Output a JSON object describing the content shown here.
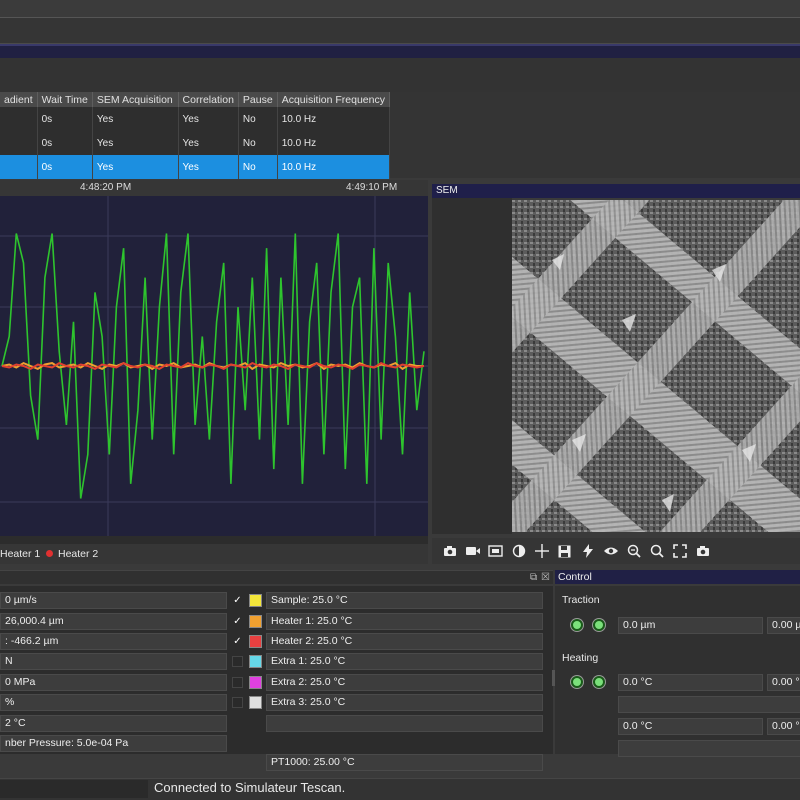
{
  "sequence_table": {
    "headers": [
      "adient",
      "Wait Time",
      "SEM Acquisition",
      "Correlation",
      "Pause",
      "Acquisition Frequency"
    ],
    "rows": [
      [
        "",
        "0s",
        "Yes",
        "Yes",
        "No",
        "10.0 Hz"
      ],
      [
        "",
        "0s",
        "Yes",
        "Yes",
        "No",
        "10.0 Hz"
      ],
      [
        "",
        "0s",
        "Yes",
        "Yes",
        "No",
        "10.0 Hz"
      ]
    ],
    "selected_row": 2
  },
  "graph": {
    "time_labels": [
      "4:48:20 PM",
      "4:49:10 PM"
    ],
    "legend": [
      "Heater 1",
      "Heater 2"
    ],
    "colors": {
      "background": "#21213a",
      "green": "#2ec42e",
      "orange": "#f0a030",
      "red": "#e04030",
      "yellow": "#e8d040"
    }
  },
  "chart_data": {
    "type": "line",
    "x": [
      0,
      1,
      2,
      3,
      4,
      5,
      6,
      7,
      8,
      9,
      10,
      11,
      12,
      13,
      14,
      15,
      16,
      17,
      18,
      19,
      20,
      21,
      22,
      23,
      24,
      25,
      26,
      27,
      28,
      29,
      30,
      31,
      32,
      33,
      34,
      35,
      36,
      37,
      38,
      39,
      40,
      41,
      42,
      43,
      44,
      45,
      46,
      47,
      48,
      49,
      50,
      51,
      52,
      53,
      54,
      55,
      56,
      57,
      58,
      59
    ],
    "series": [
      {
        "name": "",
        "color": "#2ec42e",
        "values": [
          0.0,
          0.2,
          0.9,
          0.7,
          -0.2,
          -0.5,
          0.6,
          0.9,
          0.1,
          -0.4,
          0.3,
          -0.9,
          -0.6,
          0.5,
          0.2,
          -0.6,
          0.4,
          0.8,
          -0.8,
          -0.3,
          0.6,
          -0.5,
          0.4,
          0.9,
          -0.6,
          0.5,
          0.9,
          -0.4,
          0.2,
          -0.5,
          0.3,
          0.7,
          -0.8,
          0.4,
          -0.3,
          0.6,
          -0.5,
          0.8,
          -0.7,
          0.6,
          -0.4,
          0.9,
          -0.8,
          0.3,
          0.7,
          -0.6,
          0.5,
          0.9,
          -0.7,
          0.4,
          0.6,
          -0.8,
          0.8,
          -0.5,
          0.7,
          0.2,
          -0.6,
          0.5,
          -0.3,
          0.1
        ]
      },
      {
        "name": "Heater 1",
        "color": "#f0a030",
        "values": [
          0.0,
          0.01,
          -0.01,
          0.02,
          0.0,
          -0.02,
          0.01,
          0.02,
          -0.01,
          0.0,
          0.01,
          -0.01,
          0.02,
          0.0,
          -0.02,
          0.01,
          0.0,
          0.02,
          -0.01,
          0.0,
          0.01,
          -0.02,
          0.01,
          0.0,
          0.02,
          -0.01,
          0.0,
          0.01,
          -0.01,
          0.02,
          0.0,
          -0.01,
          0.01,
          0.0,
          0.02,
          -0.02,
          0.01,
          0.0,
          -0.01,
          0.02,
          0.0,
          0.01,
          -0.01,
          0.0,
          0.02,
          -0.02,
          0.01,
          0.0,
          0.01,
          -0.01,
          0.02,
          0.0,
          -0.01,
          0.01,
          0.0,
          0.02,
          -0.02,
          0.01,
          0.0,
          0.0
        ]
      },
      {
        "name": "Heater 2",
        "color": "#e04030",
        "values": [
          0.0,
          -0.01,
          0.01,
          0.0,
          -0.02,
          0.01,
          0.0,
          -0.01,
          0.02,
          0.0,
          -0.01,
          0.01,
          0.0,
          -0.02,
          0.01,
          0.0,
          -0.01,
          0.02,
          0.0,
          -0.01,
          0.01,
          0.0,
          -0.02,
          0.01,
          0.0,
          -0.01,
          0.02,
          0.0,
          -0.01,
          0.01,
          0.0,
          -0.02,
          0.01,
          0.0,
          -0.01,
          0.02,
          0.0,
          -0.01,
          0.01,
          0.0,
          -0.02,
          0.01,
          0.0,
          -0.01,
          0.02,
          0.0,
          -0.01,
          0.01,
          0.0,
          -0.02,
          0.01,
          0.0,
          -0.01,
          0.02,
          0.0,
          -0.01,
          0.01,
          0.0,
          -0.01,
          0.0
        ]
      }
    ],
    "ylim": [
      -1.1,
      1.1
    ],
    "title": "",
    "xlabel": "",
    "ylabel": ""
  },
  "sem": {
    "title": "SEM"
  },
  "sem_toolbar": [
    "camera-icon",
    "video-icon",
    "frame-icon",
    "contrast-icon",
    "crosshair-icon",
    "save-icon",
    "flash-icon",
    "eye-icon",
    "zoom-out-icon",
    "zoom-in-icon",
    "fit-icon",
    "snapshot-icon"
  ],
  "status_fields": [
    "0 µm/s",
    "26,000.4 µm",
    ": -466.2 µm",
    "N",
    "0 MPa",
    "%",
    "2 °C",
    "nber Pressure: 5.0e-04 Pa"
  ],
  "sensors": [
    {
      "label": "Sample: 25.0 °C",
      "checked": true,
      "color": "#f3e63a"
    },
    {
      "label": "Heater 1: 25.0 °C",
      "checked": true,
      "color": "#f0a030"
    },
    {
      "label": "Heater 2: 25.0 °C",
      "checked": true,
      "color": "#e84040"
    },
    {
      "label": "Extra 1: 25.0 °C",
      "checked": false,
      "color": "#66d8e8"
    },
    {
      "label": "Extra 2: 25.0 °C",
      "checked": false,
      "color": "#e040e0"
    },
    {
      "label": "Extra 3: 25.0 °C",
      "checked": false,
      "color": "#e0e0e0"
    }
  ],
  "pt1000": "PT1000: 25.00 °C",
  "control": {
    "title": "Control",
    "traction_label": "Traction",
    "traction_value": "0.0 µm",
    "traction_right": "0.00 µ",
    "heating_label": "Heating",
    "heating_value1": "0.0 °C",
    "heating_right1": "0.00 °",
    "heating_value2": "0.0 °C",
    "heating_right2": "0.00 °"
  },
  "status_bar": {
    "text": "Connected to Simulateur Tescan."
  }
}
